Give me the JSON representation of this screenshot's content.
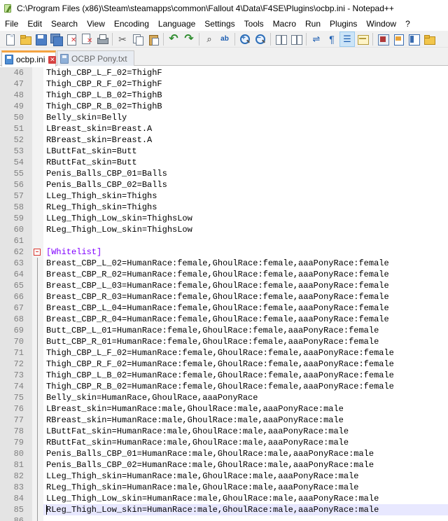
{
  "window": {
    "title": "C:\\Program Files (x86)\\Steam\\steamapps\\common\\Fallout 4\\Data\\F4SE\\Plugins\\ocbp.ini - Notepad++"
  },
  "menu": [
    {
      "label": "File"
    },
    {
      "label": "Edit"
    },
    {
      "label": "Search"
    },
    {
      "label": "View"
    },
    {
      "label": "Encoding"
    },
    {
      "label": "Language"
    },
    {
      "label": "Settings"
    },
    {
      "label": "Tools"
    },
    {
      "label": "Macro"
    },
    {
      "label": "Run"
    },
    {
      "label": "Plugins"
    },
    {
      "label": "Window"
    },
    {
      "label": "?"
    }
  ],
  "toolbar_icons": [
    "new-file",
    "open-file",
    "save",
    "save-all",
    "close",
    "close-all",
    "print",
    "cut",
    "copy",
    "paste",
    "undo",
    "redo",
    "find",
    "replace",
    "zoom-in",
    "zoom-out",
    "sync-scroll",
    "word-wrap",
    "show-all-characters",
    "indent-guide",
    "user-language",
    "document-map",
    "function-list",
    "folder-as-workspace"
  ],
  "tabs": [
    {
      "label": "ocbp.ini",
      "active": true,
      "saved": true
    },
    {
      "label": "OCBP Pony.txt",
      "active": false,
      "saved": false
    }
  ],
  "editor": {
    "current_line": 85,
    "lines": [
      {
        "num": "46",
        "text": "Thigh_CBP_L_F_02=ThighF"
      },
      {
        "num": "47",
        "text": "Thigh_CBP_R_F_02=ThighF"
      },
      {
        "num": "48",
        "text": "Thigh_CBP_L_B_02=ThighB"
      },
      {
        "num": "49",
        "text": "Thigh_CBP_R_B_02=ThighB"
      },
      {
        "num": "50",
        "text": "Belly_skin=Belly"
      },
      {
        "num": "51",
        "text": "LBreast_skin=Breast.A"
      },
      {
        "num": "52",
        "text": "RBreast_skin=Breast.A"
      },
      {
        "num": "53",
        "text": "LButtFat_skin=Butt"
      },
      {
        "num": "54",
        "text": "RButtFat_skin=Butt"
      },
      {
        "num": "55",
        "text": "Penis_Balls_CBP_01=Balls"
      },
      {
        "num": "56",
        "text": "Penis_Balls_CBP_02=Balls"
      },
      {
        "num": "57",
        "text": "LLeg_Thigh_skin=Thighs"
      },
      {
        "num": "58",
        "text": "RLeg_Thigh_skin=Thighs"
      },
      {
        "num": "59",
        "text": "LLeg_Thigh_Low_skin=ThighsLow"
      },
      {
        "num": "60",
        "text": "RLeg_Thigh_Low_skin=ThighsLow"
      },
      {
        "num": "61",
        "text": ""
      },
      {
        "num": "62",
        "text": "[Whitelist]",
        "section": true
      },
      {
        "num": "63",
        "text": "Breast_CBP_L_02=HumanRace:female,GhoulRace:female,aaaPonyRace:female"
      },
      {
        "num": "64",
        "text": "Breast_CBP_R_02=HumanRace:female,GhoulRace:female,aaaPonyRace:female"
      },
      {
        "num": "65",
        "text": "Breast_CBP_L_03=HumanRace:female,GhoulRace:female,aaaPonyRace:female"
      },
      {
        "num": "66",
        "text": "Breast_CBP_R_03=HumanRace:female,GhoulRace:female,aaaPonyRace:female"
      },
      {
        "num": "67",
        "text": "Breast_CBP_L_04=HumanRace:female,GhoulRace:female,aaaPonyRace:female"
      },
      {
        "num": "68",
        "text": "Breast_CBP_R_04=HumanRace:female,GhoulRace:female,aaaPonyRace:female"
      },
      {
        "num": "69",
        "text": "Butt_CBP_L_01=HumanRace:female,GhoulRace:female,aaaPonyRace:female"
      },
      {
        "num": "70",
        "text": "Butt_CBP_R_01=HumanRace:female,GhoulRace:female,aaaPonyRace:female"
      },
      {
        "num": "71",
        "text": "Thigh_CBP_L_F_02=HumanRace:female,GhoulRace:female,aaaPonyRace:female"
      },
      {
        "num": "72",
        "text": "Thigh_CBP_R_F_02=HumanRace:female,GhoulRace:female,aaaPonyRace:female"
      },
      {
        "num": "73",
        "text": "Thigh_CBP_L_B_02=HumanRace:female,GhoulRace:female,aaaPonyRace:female"
      },
      {
        "num": "74",
        "text": "Thigh_CBP_R_B_02=HumanRace:female,GhoulRace:female,aaaPonyRace:female"
      },
      {
        "num": "75",
        "text": "Belly_skin=HumanRace,GhoulRace,aaaPonyRace"
      },
      {
        "num": "76",
        "text": "LBreast_skin=HumanRace:male,GhoulRace:male,aaaPonyRace:male"
      },
      {
        "num": "77",
        "text": "RBreast_skin=HumanRace:male,GhoulRace:male,aaaPonyRace:male"
      },
      {
        "num": "78",
        "text": "LButtFat_skin=HumanRace:male,GhoulRace:male,aaaPonyRace:male"
      },
      {
        "num": "79",
        "text": "RButtFat_skin=HumanRace:male,GhoulRace:male,aaaPonyRace:male"
      },
      {
        "num": "80",
        "text": "Penis_Balls_CBP_01=HumanRace:male,GhoulRace:male,aaaPonyRace:male"
      },
      {
        "num": "81",
        "text": "Penis_Balls_CBP_02=HumanRace:male,GhoulRace:male,aaaPonyRace:male"
      },
      {
        "num": "82",
        "text": "LLeg_Thigh_skin=HumanRace:male,GhoulRace:male,aaaPonyRace:male"
      },
      {
        "num": "83",
        "text": "RLeg_Thigh_skin=HumanRace:male,GhoulRace:male,aaaPonyRace:male"
      },
      {
        "num": "84",
        "text": "LLeg_Thigh_Low_skin=HumanRace:male,GhoulRace:male,aaaPonyRace:male"
      },
      {
        "num": "85",
        "text": "RLeg_Thigh_Low_skin=HumanRace:male,GhoulRace:male,aaaPonyRace:male"
      },
      {
        "num": "86",
        "text": ""
      }
    ]
  },
  "colors": {
    "gutter_bg": "#e4e4e4",
    "current_line_bg": "#e8e8ff",
    "section_text": "#8000ff",
    "active_tab_accent": "#f4a340"
  }
}
